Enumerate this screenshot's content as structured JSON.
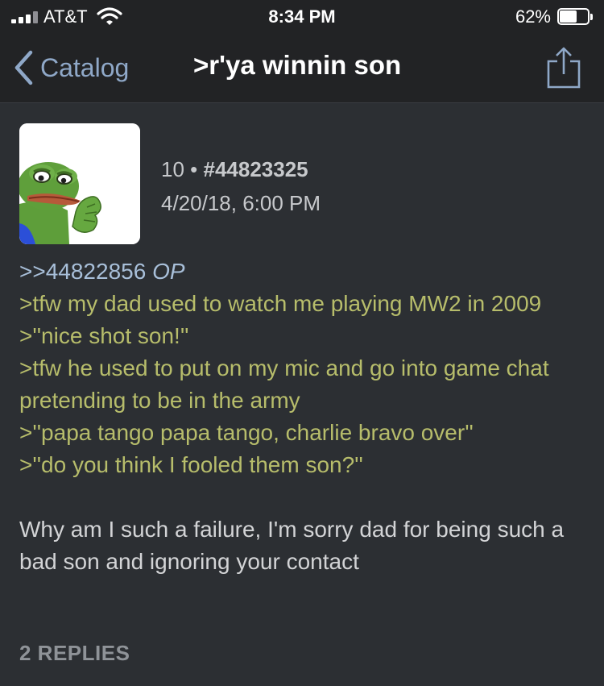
{
  "status_bar": {
    "carrier": "AT&T",
    "time": "8:34 PM",
    "battery_percent": "62%",
    "battery_level": 0.62
  },
  "nav": {
    "back_label": "Catalog",
    "title": ">r'ya winnin son"
  },
  "post": {
    "reply_count": "10",
    "separator": "•",
    "post_number": "#44823325",
    "date": "4/20/18, 6:00 PM",
    "quote_ref": ">>44822856",
    "op_tag": "OP",
    "greentext": [
      ">tfw my dad used to watch me playing MW2 in 2009",
      ">''nice shot son!''",
      ">tfw he used to put on my mic and go into game chat pretending to be in the army",
      ">''papa tango papa tango, charlie bravo over''",
      ">''do you think I fooled them son?''"
    ],
    "text": "Why am I such a failure, I'm sorry dad for being such a bad son and ignoring your contact",
    "replies_label": "2 REPLIES"
  },
  "colors": {
    "background": "#2c2f33",
    "chrome": "#222325",
    "link": "#8fa8c8",
    "greentext": "#b7bd6b",
    "body_text": "#d3d4d6"
  },
  "icons": {
    "signal": "cellular-signal-icon",
    "wifi": "wifi-icon",
    "battery": "battery-icon",
    "back": "chevron-left-icon",
    "share": "share-icon"
  }
}
